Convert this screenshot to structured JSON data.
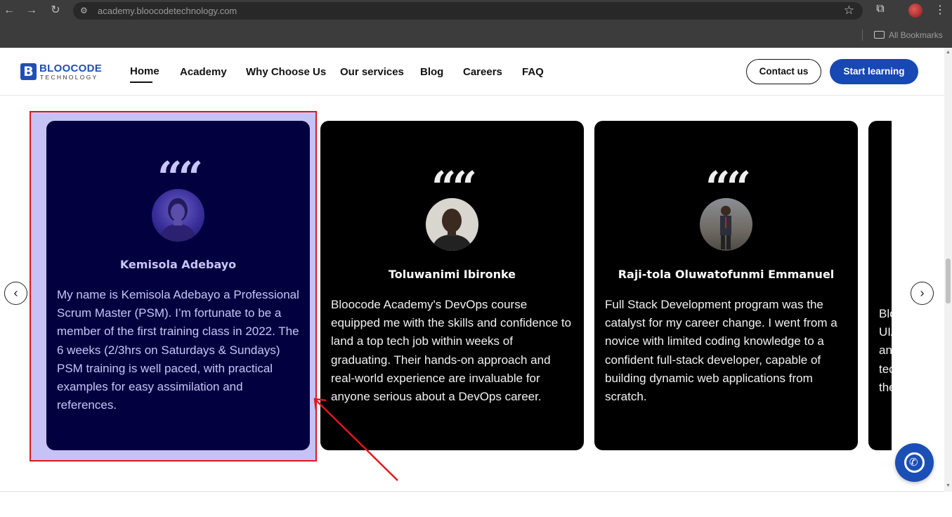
{
  "browser": {
    "url": "academy.bloocodetechnology.com",
    "bookmarks_label": "All Bookmarks"
  },
  "header": {
    "logo_name": "BLOOCODE",
    "logo_sub": "TECHNOLOGY",
    "logo_mark": "B",
    "nav": [
      "Home",
      "Academy",
      "Why Choose Us",
      "Our services",
      "Blog",
      "Careers",
      "FAQ"
    ],
    "active_nav": "Home",
    "contact_label": "Contact us",
    "start_label": "Start learning"
  },
  "testimonials": [
    {
      "name": "Kemisola Adebayo",
      "text": "My name is Kemisola Adebayo a Professional Scrum Master (PSM). I’m fortunate to be a member of the first training class in 2022. The 6 weeks (2/3hrs on Saturdays & Sundays) PSM training is well paced, with practical examples for easy assimilation and references.",
      "selected": true
    },
    {
      "name": "Toluwanimi Ibironke",
      "text": "Bloocode Academy's DevOps course equipped me with the skills and confidence to land a top tech job within weeks of graduating. Their hands-on approach and real-world experience are invaluable for anyone serious about a DevOps career.",
      "selected": false
    },
    {
      "name": "Raji-tola Oluwatofunmi Emmanuel",
      "text": "Full Stack Development program was the catalyst for my career change. I went from a novice with limited coding knowledge to a confident full-stack developer, capable of building dynamic web applications from scratch.",
      "selected": false
    },
    {
      "name": "",
      "text": "Blo\nUI/\nan\ntec\nthe",
      "selected": false
    }
  ],
  "quote_mark": "“",
  "colors": {
    "brand_blue": "#1748b4",
    "selected_card_bg": "#03003f",
    "highlight_bg": "#c6c2f6",
    "highlight_border": "#e3161d",
    "annotation_arrow": "#e3161d"
  }
}
